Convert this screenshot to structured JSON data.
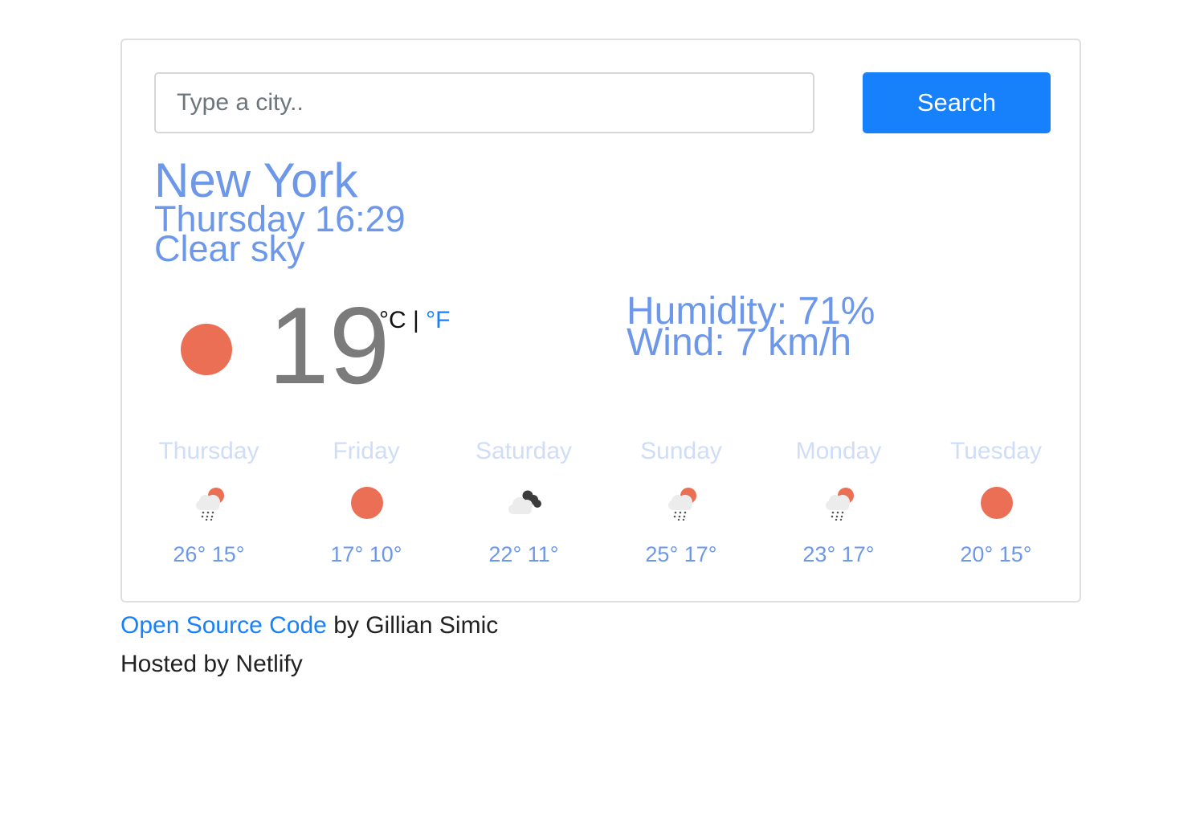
{
  "search": {
    "placeholder": "Type a city..",
    "value": "",
    "button_label": "Search"
  },
  "current": {
    "city": "New York",
    "datetime": "Thursday 16:29",
    "description": "Clear sky",
    "icon": "clear-sun-icon",
    "temperature": "19",
    "unit_celsius": "°C",
    "unit_separator": "|",
    "unit_fahrenheit": "°F",
    "humidity": "Humidity: 71%",
    "wind": "Wind: 7 km/h"
  },
  "forecast": [
    {
      "day": "Thursday",
      "icon": "rain-sun-icon",
      "temps": "26° 15°"
    },
    {
      "day": "Friday",
      "icon": "clear-sun-icon",
      "temps": "17° 10°"
    },
    {
      "day": "Saturday",
      "icon": "cloudy-icon",
      "temps": "22° 11°"
    },
    {
      "day": "Sunday",
      "icon": "rain-sun-icon",
      "temps": "25° 17°"
    },
    {
      "day": "Monday",
      "icon": "rain-sun-icon",
      "temps": "23° 17°"
    },
    {
      "day": "Tuesday",
      "icon": "clear-sun-icon",
      "temps": "20° 15°"
    }
  ],
  "footer": {
    "source_link": "Open Source Code",
    "author_text": "by Gillian Simic",
    "hosted_text": "Hosted by Netlify"
  },
  "colors": {
    "accent": "#1780fb",
    "text_blue": "#6d98ea",
    "day_name": "#d0ddf7",
    "sun": "#eb6f55"
  }
}
